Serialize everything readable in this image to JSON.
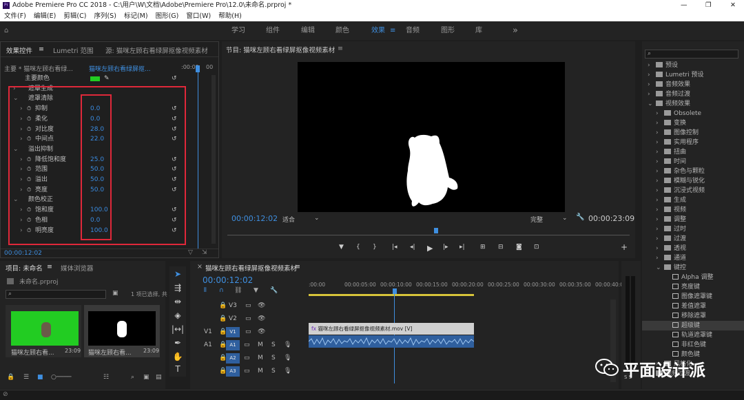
{
  "window": {
    "title": "Adobe Premiere Pro CC 2018 - C:\\用户\\W\\文档\\Adobe\\Premiere Pro\\12.0\\未命名.prproj *",
    "min": "—",
    "restore": "❐",
    "close": "✕"
  },
  "menu": [
    "文件(F)",
    "编辑(E)",
    "剪辑(C)",
    "序列(S)",
    "标记(M)",
    "图形(G)",
    "窗口(W)",
    "帮助(H)"
  ],
  "workspaces": {
    "items": [
      "学习",
      "组件",
      "编辑",
      "颜色",
      "效果",
      "音频",
      "图形",
      "库"
    ],
    "active": "效果",
    "more": "»"
  },
  "effect_controls": {
    "tabs": [
      "效果控件",
      "Lumetri 范围",
      "源: 猫咪左顾右看绿屏抠像视频素材"
    ],
    "master": "主要 * 猫咪左顾右看绿...",
    "clip": "猫咪左顾右看绿屏抠...",
    "time": ":00:00",
    "time2": "00",
    "rows": [
      {
        "label": "主要颜色",
        "indent": 35,
        "type": "color"
      },
      {
        "label": "遮罩生成",
        "indent": 40,
        "chev": "›"
      },
      {
        "label": "遮罩清除",
        "indent": 40,
        "chev": "⌄"
      },
      {
        "label": "抑制",
        "indent": 50,
        "value": "0.0",
        "chev": "›",
        "stop": true
      },
      {
        "label": "柔化",
        "indent": 50,
        "value": "0.0",
        "chev": "›",
        "stop": true
      },
      {
        "label": "对比度",
        "indent": 50,
        "value": "28.0",
        "chev": "›",
        "stop": true
      },
      {
        "label": "中间点",
        "indent": 50,
        "value": "22.0",
        "chev": "›",
        "stop": true
      },
      {
        "label": "溢出抑制",
        "indent": 40,
        "chev": "⌄"
      },
      {
        "label": "降低饱和度",
        "indent": 50,
        "value": "25.0",
        "chev": "›",
        "stop": true
      },
      {
        "label": "范围",
        "indent": 50,
        "value": "50.0",
        "chev": "›",
        "stop": true
      },
      {
        "label": "溢出",
        "indent": 50,
        "value": "50.0",
        "chev": "›",
        "stop": true
      },
      {
        "label": "亮度",
        "indent": 50,
        "value": "50.0",
        "chev": "›",
        "stop": true
      },
      {
        "label": "颜色校正",
        "indent": 40,
        "chev": "⌄"
      },
      {
        "label": "饱和度",
        "indent": 50,
        "value": "100.0",
        "chev": "›",
        "stop": true
      },
      {
        "label": "色相",
        "indent": 50,
        "value": "0.0",
        "chev": "›",
        "stop": true
      },
      {
        "label": "明亮度",
        "indent": 50,
        "value": "100.0",
        "chev": "›",
        "stop": true
      }
    ],
    "timecode": "00:00:12:02"
  },
  "program": {
    "tab": "节目: 猫咪左顾右看绿屏抠像视频素材",
    "timecode": "00:00:12:02",
    "fit": "适合",
    "quality": "完整",
    "duration": "00:00:23:09"
  },
  "effects": {
    "search": "",
    "items": [
      {
        "label": "预设",
        "lvl": 0
      },
      {
        "label": "Lumetri 预设",
        "lvl": 0
      },
      {
        "label": "音频效果",
        "lvl": 0
      },
      {
        "label": "音频过渡",
        "lvl": 0
      },
      {
        "label": "视频效果",
        "lvl": 0,
        "open": true
      },
      {
        "label": "Obsolete",
        "lvl": 1
      },
      {
        "label": "变换",
        "lvl": 1
      },
      {
        "label": "图像控制",
        "lvl": 1
      },
      {
        "label": "实用程序",
        "lvl": 1
      },
      {
        "label": "扭曲",
        "lvl": 1
      },
      {
        "label": "时间",
        "lvl": 1
      },
      {
        "label": "杂色与颗粒",
        "lvl": 1
      },
      {
        "label": "模糊与锐化",
        "lvl": 1
      },
      {
        "label": "沉浸式视频",
        "lvl": 1
      },
      {
        "label": "生成",
        "lvl": 1
      },
      {
        "label": "视频",
        "lvl": 1
      },
      {
        "label": "调整",
        "lvl": 1
      },
      {
        "label": "过时",
        "lvl": 1
      },
      {
        "label": "过渡",
        "lvl": 1
      },
      {
        "label": "透视",
        "lvl": 1
      },
      {
        "label": "通道",
        "lvl": 1
      },
      {
        "label": "键控",
        "lvl": 1,
        "open": true
      },
      {
        "label": "Alpha 调整",
        "lvl": 2
      },
      {
        "label": "亮度键",
        "lvl": 2
      },
      {
        "label": "图像遮罩键",
        "lvl": 2
      },
      {
        "label": "差值遮罩",
        "lvl": 2
      },
      {
        "label": "移除遮罩",
        "lvl": 2
      },
      {
        "label": "超级键",
        "lvl": 2,
        "sel": true
      },
      {
        "label": "轨道遮罩键",
        "lvl": 2
      },
      {
        "label": "非红色键",
        "lvl": 2
      },
      {
        "label": "颜色键",
        "lvl": 2
      },
      {
        "label": "风格化",
        "lvl": 1
      },
      {
        "label": "视频过渡",
        "lvl": 0
      }
    ]
  },
  "project": {
    "tabs": [
      "项目: 未命名",
      "媒体浏览器"
    ],
    "file": "未命名.prproj",
    "count": "1 项已选择, 共 2 项",
    "search": "",
    "items": [
      {
        "name": "猫咪左顾右看...",
        "dur": "23:09"
      },
      {
        "name": "猫咪左顾右看...",
        "dur": "23:09"
      }
    ]
  },
  "timeline": {
    "tab": "猫咪左顾右看绿屏抠像视频素材",
    "timecode": "00:00:12:02",
    "ruler": [
      ":00:00",
      "00:00:05:00",
      "00:00:10:00",
      "00:00:15:00",
      "00:00:20:00",
      "00:00:25:00",
      "00:00:30:00",
      "00:00:35:00",
      "00:00:40:0"
    ],
    "tracks": [
      {
        "a": "",
        "b": "V3"
      },
      {
        "a": "",
        "b": "V2"
      },
      {
        "a": "V1",
        "b": "V1"
      },
      {
        "a": "A1",
        "b": "A1"
      },
      {
        "a": "",
        "b": "A2"
      },
      {
        "a": "",
        "b": "A3"
      }
    ],
    "clip": "猫咪左顾右看绿屏抠像视频素材.mov [V]",
    "meter": "S S"
  },
  "watermark": "平面设计派",
  "colors": {
    "accent": "#3f8fe0",
    "red": "#e0283a",
    "key": "#22cc22"
  }
}
